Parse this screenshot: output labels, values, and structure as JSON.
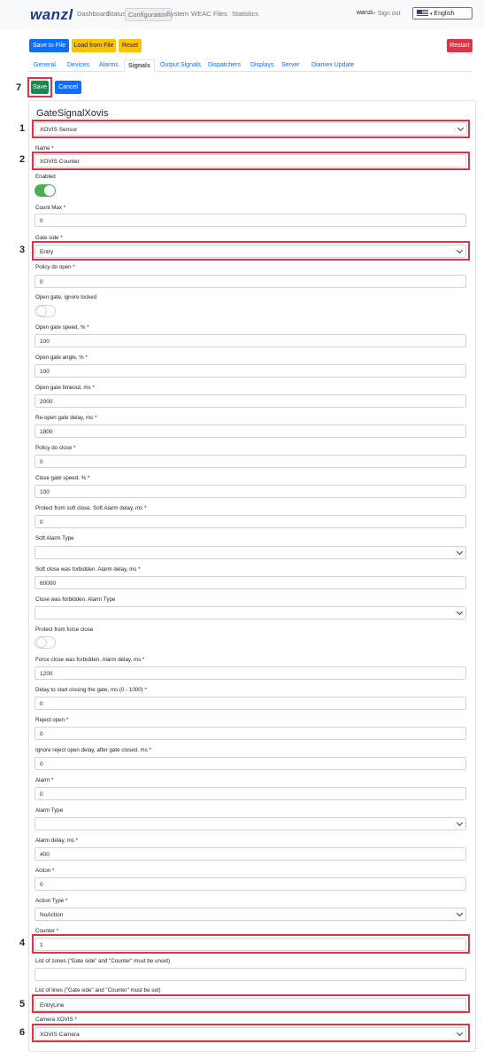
{
  "navbar": {
    "brand": "wanzl",
    "links": [
      "Dashboard",
      "Status",
      "Configuration",
      "System",
      "WEAC",
      "Files",
      "Statistics"
    ],
    "active": "Configuration",
    "user": "wanzi",
    "signout": "Sign out",
    "language": "English"
  },
  "toolbar": {
    "save_to_file": "Save to File",
    "load_from_file": "Load from File",
    "reset": "Reset",
    "restart": "Restart"
  },
  "tabs": [
    "General",
    "Devices",
    "Alarms",
    "Signals",
    "Output Signals",
    "Dispatchers",
    "Displays",
    "Server",
    "Diamex Update"
  ],
  "active_tab": "Signals",
  "actions": {
    "save": "Save",
    "cancel": "Cancel"
  },
  "markers": [
    "1",
    "2",
    "3",
    "4",
    "5",
    "6",
    "7"
  ],
  "colors": {
    "primary": "#0d6efd",
    "warning": "#ffc107",
    "danger": "#dc3545",
    "success": "#198754",
    "switch_on": "#4caf50",
    "highlight": "#dc3545"
  },
  "form": {
    "title": "GateSignalXovis",
    "signal_type": "XOVIS Sensor",
    "fields": {
      "name": {
        "label": "Name *",
        "value": "XOVIS Counter"
      },
      "enabled": {
        "label": "Enabled",
        "value": true
      },
      "count_max": {
        "label": "Count Max *",
        "value": "0"
      },
      "gate_side": {
        "label": "Gate side *",
        "value": "Entry"
      },
      "policy_do_open": {
        "label": "Policy do open *",
        "value": "0"
      },
      "open_gate_ignore_locked": {
        "label": "Open gate, ignore locked",
        "value": false
      },
      "open_gate_speed": {
        "label": "Open gate speed, % *",
        "value": "100"
      },
      "open_gate_angle": {
        "label": "Open gate angle, % *",
        "value": "100"
      },
      "open_gate_timeout": {
        "label": "Open gate timeout, ms *",
        "value": "2000"
      },
      "reopen_gate_delay": {
        "label": "Re-open gate delay, ms *",
        "value": "1800"
      },
      "policy_do_close": {
        "label": "Policy do close *",
        "value": "0"
      },
      "close_gate_speed": {
        "label": "Close gate speed, % *",
        "value": "100"
      },
      "protect_soft_close": {
        "label": "Protect from soft close. Soft Alarm delay, ms *",
        "value": "0"
      },
      "soft_alarm_type": {
        "label": "Soft Alarm Type",
        "value": ""
      },
      "soft_close_forbidden": {
        "label": "Soft close was forbidden. Alarm delay, ms *",
        "value": "60000"
      },
      "close_forbidden_alarm_type": {
        "label": "Close was forbidden. Alarm Type",
        "value": ""
      },
      "protect_force_close": {
        "label": "Protect from force close",
        "value": false
      },
      "force_close_forbidden": {
        "label": "Force close was forbidden. Alarm delay, ms *",
        "value": "1200"
      },
      "delay_start_closing": {
        "label": "Delay to start closing the gate, ms (0 - 1000) *",
        "value": "0"
      },
      "reject_open": {
        "label": "Reject open *",
        "value": "0"
      },
      "ignore_reject_open_delay": {
        "label": "Ignore reject open delay, after gate closed, ms *",
        "value": "0"
      },
      "alarm": {
        "label": "Alarm *",
        "value": "0"
      },
      "alarm_type": {
        "label": "Alarm Type",
        "value": ""
      },
      "alarm_delay": {
        "label": "Alarm delay, ms *",
        "value": "400"
      },
      "action": {
        "label": "Action *",
        "value": "0"
      },
      "action_type": {
        "label": "Action Type *",
        "value": "NoAction"
      },
      "counter": {
        "label": "Counter *",
        "value": "1"
      },
      "list_of_zones": {
        "label": "List of zones (\"Gate side\" and \"Counter\" must be unset)",
        "value": ""
      },
      "list_of_lines": {
        "label": "List of lines (\"Gate side\" and \"Counter\" must be set)",
        "value": "EntryLine"
      },
      "camera_xovis": {
        "label": "Camera XOVIS *",
        "value": "XOVIS Camera"
      }
    }
  }
}
